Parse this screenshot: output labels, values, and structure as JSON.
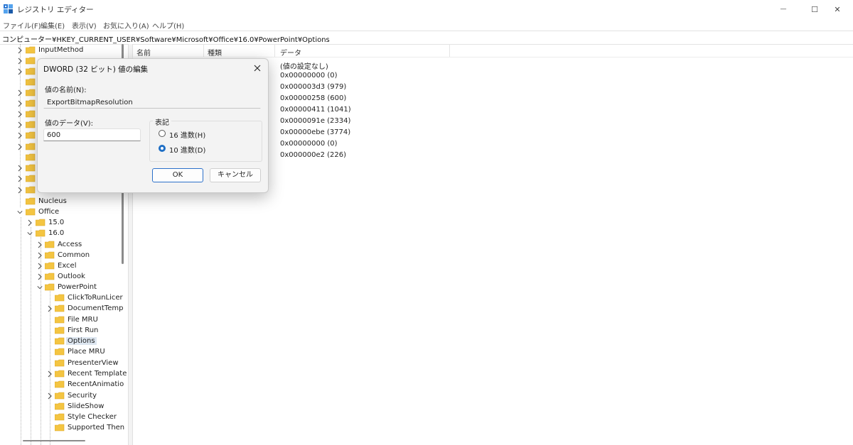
{
  "window": {
    "title": "レジストリ エディター",
    "controls": {
      "minimize": "—",
      "maximize": "☐",
      "close": "✕"
    }
  },
  "menu": [
    "ファイル(F)",
    "編集(E)",
    "表示(V)",
    "お気に入り(A)",
    "ヘルプ(H)"
  ],
  "address": "コンピューター¥HKEY_CURRENT_USER¥Software¥Microsoft¥Office¥16.0¥PowerPoint¥Options",
  "tree": {
    "items": [
      {
        "label": "InputMethod"
      },
      {
        "label": "Nucleus"
      },
      {
        "label": "Office"
      },
      {
        "label": "15.0"
      },
      {
        "label": "16.0"
      },
      {
        "label": "Access"
      },
      {
        "label": "Common"
      },
      {
        "label": "Excel"
      },
      {
        "label": "Outlook"
      },
      {
        "label": "PowerPoint"
      },
      {
        "label": "ClickToRunLicer"
      },
      {
        "label": "DocumentTemp"
      },
      {
        "label": "File MRU"
      },
      {
        "label": "First Run"
      },
      {
        "label": "Options"
      },
      {
        "label": "Place MRU"
      },
      {
        "label": "PresenterView"
      },
      {
        "label": "Recent Template"
      },
      {
        "label": "RecentAnimatio"
      },
      {
        "label": "Security"
      },
      {
        "label": "SlideShow"
      },
      {
        "label": "Style Checker"
      },
      {
        "label": "Supported Then"
      }
    ]
  },
  "list": {
    "columns": {
      "name": "名前",
      "type": "種類",
      "data": "データ"
    },
    "data_values": [
      "(値の設定なし)",
      "0x00000000 (0)",
      "0x000003d3 (979)",
      "0x00000258 (600)",
      "0x00000411 (1041)",
      "0x0000091e (2334)",
      "0x00000ebe (3774)",
      "0x00000000 (0)",
      "0x000000e2 (226)"
    ]
  },
  "dialog": {
    "title": "DWORD (32 ビット) 値の編集",
    "value_name_label": "値の名前(N):",
    "value_name": "ExportBitmapResolution",
    "value_data_label": "値のデータ(V):",
    "value_data": "600",
    "base_label": "表記",
    "hex_label": "16 進数(H)",
    "dec_label": "10 進数(D)",
    "selected_base": "decimal",
    "ok_label": "OK",
    "cancel_label": "キャンセル"
  },
  "colors": {
    "folder": "#f4c542",
    "accent": "#1f6fc5",
    "selection": "#dde6f0"
  }
}
